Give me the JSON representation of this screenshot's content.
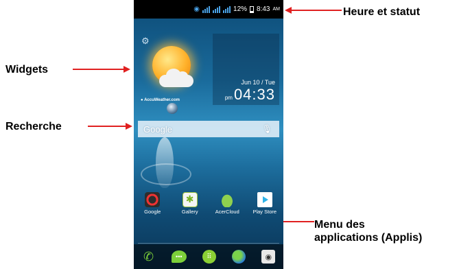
{
  "callouts": {
    "status": "Heure et statut",
    "widgets": "Widgets",
    "search": "Recherche",
    "app_menu": "Menu des\napplications (Applis)"
  },
  "statusbar": {
    "battery": "12%",
    "time": "8:43",
    "ampm": "AM",
    "icons": [
      "wifi-icon",
      "signal-icon",
      "signal-icon",
      "signal-icon",
      "battery-icon"
    ]
  },
  "weather": {
    "provider": "AccuWeather.com",
    "icon": "partly-sunny-icon"
  },
  "clock": {
    "date": "Jun 10 / Tue",
    "ampm": "pm",
    "time": "04:33"
  },
  "search": {
    "brand": "Google",
    "mic": "mic-icon"
  },
  "apps": [
    {
      "label": "Google"
    },
    {
      "label": "Gallery"
    },
    {
      "label": "AcerCloud"
    },
    {
      "label": "Play Store"
    }
  ],
  "dock": [
    "phone-icon",
    "messaging-icon",
    "apps-icon",
    "browser-icon",
    "camera-icon"
  ],
  "colors": {
    "arrow": "#e02020",
    "accent": "#4aa3e8",
    "green": "#7ccf3a"
  }
}
